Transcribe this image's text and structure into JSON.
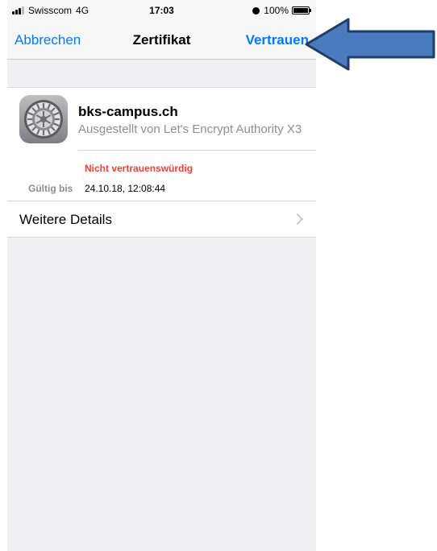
{
  "status_bar": {
    "carrier": "Swisscom",
    "network": "4G",
    "time": "17:03",
    "battery": "100%",
    "icons": [
      "signal-icon",
      "alarm-icon",
      "battery-icon"
    ]
  },
  "nav": {
    "cancel_label": "Abbrechen",
    "title": "Zertifikat",
    "trust_label": "Vertrauen"
  },
  "certificate": {
    "name": "bks-campus.ch",
    "issuer": "Ausgestellt von Let's Encrypt Authority X3",
    "trust_status": "Nicht vertrauenswürdig",
    "expiry_label": "Gültig bis",
    "expiry_value": "24.10.18, 12:08:44",
    "details_label": "Weitere Details"
  },
  "colors": {
    "accent": "#007aff",
    "warning": "#ff3b30",
    "arrow_fill": "#4a7bbf",
    "arrow_stroke": "#1f3f6a",
    "background": "#efeff4"
  }
}
